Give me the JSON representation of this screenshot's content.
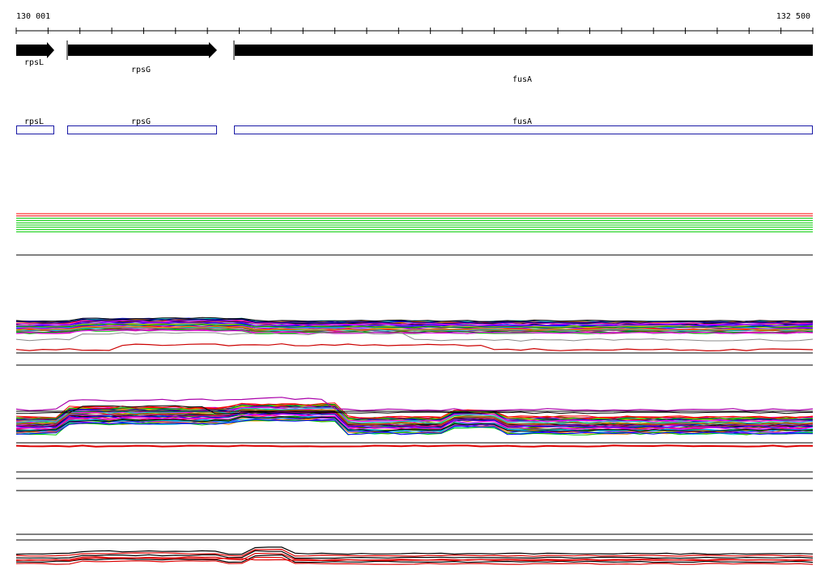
{
  "ruler": {
    "start_label": "130 001",
    "end_label": "132 500",
    "start": 130001,
    "end": 132500
  },
  "genes": [
    {
      "name": "rpsL",
      "arrow_label": "rpsL",
      "box_label": "rpsL"
    },
    {
      "name": "rpsG",
      "arrow_label": "rpsG",
      "box_label": "rpsG"
    },
    {
      "name": "fusA",
      "arrow_label": "fusA",
      "box_label": "fusA"
    }
  ],
  "colors": {
    "arrow": "#000000",
    "box": "#1a1aa6",
    "palette": [
      "#ff0000",
      "#00cc00",
      "#0000ff",
      "#ff00ff",
      "#00cccc",
      "#cccc00",
      "#ff8800",
      "#8800ff",
      "#008800",
      "#000088",
      "#888888",
      "#cc0088",
      "#00aaff",
      "#aa5500",
      "#000000"
    ]
  }
}
